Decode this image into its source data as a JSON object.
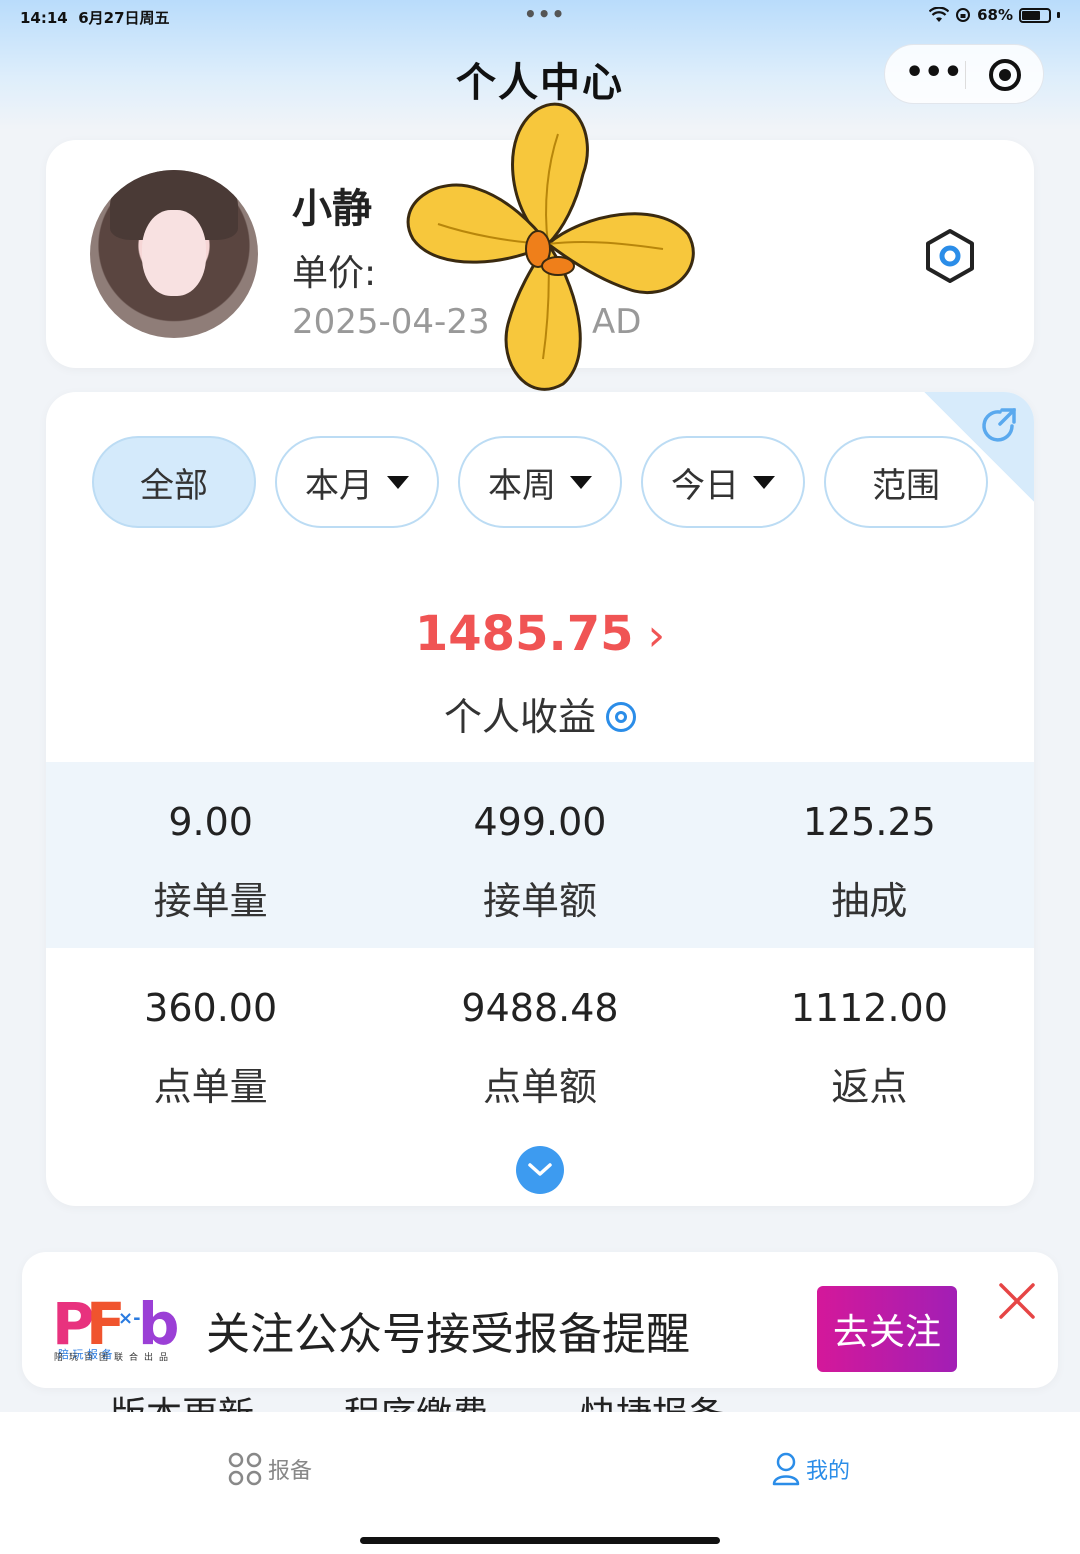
{
  "status_bar": {
    "time": "14:14",
    "date": "6月27日周五",
    "dots": "•••",
    "battery": "68%",
    "battery_level": 0.68
  },
  "nav": {
    "title": "个人中心",
    "more_label": "•••"
  },
  "profile": {
    "name": "小静",
    "price_label": "单价:",
    "price_value": "",
    "date": "2025-04-23",
    "id_fragment": "AD"
  },
  "filters": {
    "tabs": [
      {
        "label": "全部",
        "active": true,
        "dropdown": false
      },
      {
        "label": "本月",
        "active": false,
        "dropdown": true
      },
      {
        "label": "本周",
        "active": false,
        "dropdown": true
      },
      {
        "label": "今日",
        "active": false,
        "dropdown": true
      },
      {
        "label": "范围",
        "active": false,
        "dropdown": false
      }
    ]
  },
  "income": {
    "value": "1485.75",
    "arrow": "›",
    "label": "个人收益"
  },
  "stats": {
    "row1": [
      {
        "value": "9.00",
        "label": "接单量"
      },
      {
        "value": "499.00",
        "label": "接单额"
      },
      {
        "value": "125.25",
        "label": "抽成"
      }
    ],
    "row2": [
      {
        "value": "360.00",
        "label": "点单量"
      },
      {
        "value": "9488.48",
        "label": "点单额"
      },
      {
        "value": "1112.00",
        "label": "返点"
      }
    ]
  },
  "banner": {
    "text": "关注公众号接受报备提醒",
    "button": "去关注",
    "logo_sub": "陪·玩·报·备",
    "logo_tagline": "陪玩百团联合出品"
  },
  "peek_items": [
    "版本更新",
    "程序缴费",
    "快捷报备"
  ],
  "tabbar": {
    "left_label": "报备",
    "right_label": "我的"
  },
  "colors": {
    "accent": "#2b8de8",
    "income": "#f05454",
    "follow_button": "#c21aa5"
  }
}
